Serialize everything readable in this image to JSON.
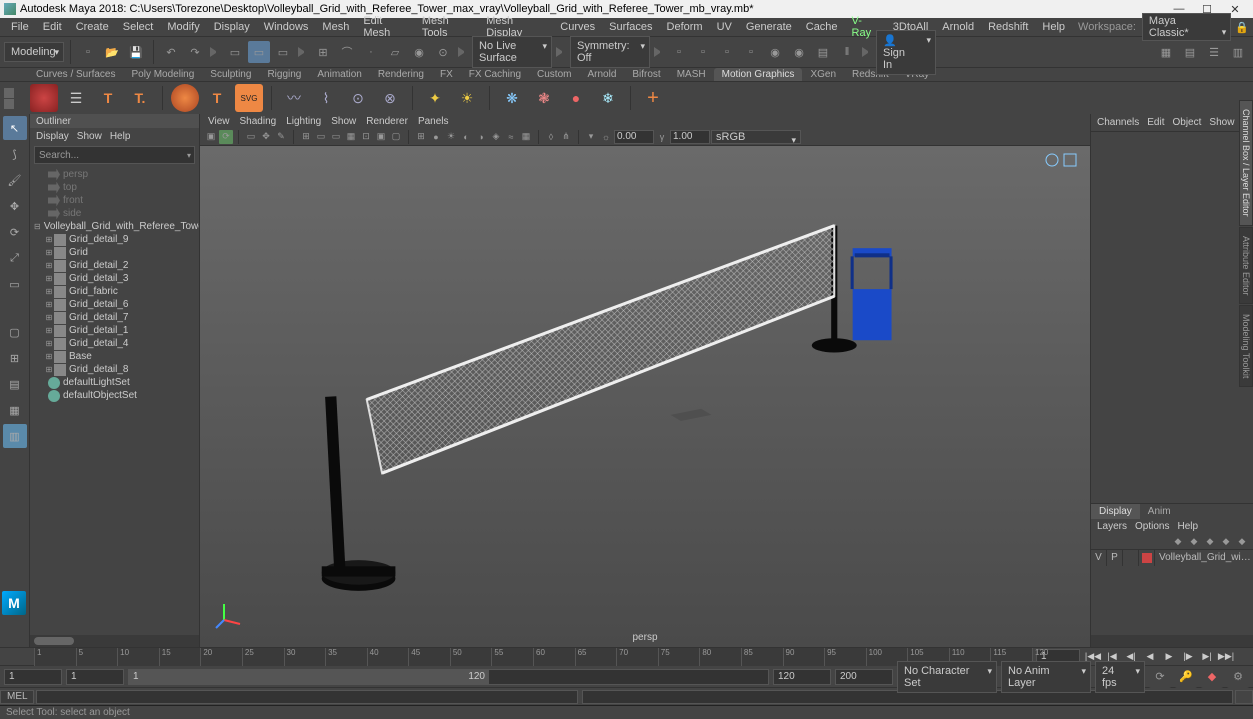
{
  "title": "Autodesk Maya 2018: C:\\Users\\Torezone\\Desktop\\Volleyball_Grid_with_Referee_Tower_max_vray\\Volleyball_Grid_with_Referee_Tower_mb_vray.mb*",
  "workspace_label": "Workspace:",
  "workspace_value": "Maya Classic*",
  "menubar": [
    "File",
    "Edit",
    "Create",
    "Select",
    "Modify",
    "Display",
    "Windows",
    "Mesh",
    "Edit Mesh",
    "Mesh Tools",
    "Mesh Display",
    "Curves",
    "Surfaces",
    "Deform",
    "UV",
    "Generate",
    "Cache",
    "V-Ray",
    "3DtoAll",
    "Arnold",
    "Redshift",
    "Help"
  ],
  "mode_combo": "Modeling",
  "no_live_surface": "No Live Surface",
  "symmetry": "Symmetry: Off",
  "signin": "Sign In",
  "shelf_tabs": [
    "Curves / Surfaces",
    "Poly Modeling",
    "Sculpting",
    "Rigging",
    "Animation",
    "Rendering",
    "FX",
    "FX Caching",
    "Custom",
    "Arnold",
    "Bifrost",
    "MASH",
    "Motion Graphics",
    "XGen",
    "Redshift",
    "VRay"
  ],
  "shelf_active_idx": 12,
  "outliner": {
    "title": "Outliner",
    "menu": [
      "Display",
      "Show",
      "Help"
    ],
    "search_placeholder": "Search...",
    "cameras": [
      "persp",
      "top",
      "front",
      "side"
    ],
    "root": "Volleyball_Grid_with_Referee_Tower_",
    "children": [
      "Grid_detail_9",
      "Grid",
      "Grid_detail_2",
      "Grid_detail_3",
      "Grid_fabric",
      "Grid_detail_6",
      "Grid_detail_7",
      "Grid_detail_1",
      "Grid_detail_4",
      "Base",
      "Grid_detail_8"
    ],
    "sets": [
      "defaultLightSet",
      "defaultObjectSet"
    ]
  },
  "viewport": {
    "menu": [
      "View",
      "Shading",
      "Lighting",
      "Show",
      "Renderer",
      "Panels"
    ],
    "exposure": "0.00",
    "gamma": "1.00",
    "colorspace": "sRGB gamma",
    "camera_label": "persp"
  },
  "channelbox": {
    "menu": [
      "Channels",
      "Edit",
      "Object",
      "Show"
    ]
  },
  "layers": {
    "tabs": [
      "Display",
      "Anim"
    ],
    "menu": [
      "Layers",
      "Options",
      "Help"
    ],
    "row": {
      "v": "V",
      "p": "P",
      "name": "Volleyball_Grid_with_Referee_"
    }
  },
  "right_vtabs": [
    "Channel Box / Layer Editor",
    "Attribute Editor",
    "Modeling Toolkit"
  ],
  "timeline": {
    "current": "1",
    "ticks": [
      "1",
      "5",
      "10",
      "15",
      "20",
      "25",
      "30",
      "35",
      "40",
      "45",
      "50",
      "55",
      "60",
      "65",
      "70",
      "75",
      "80",
      "85",
      "90",
      "95",
      "100",
      "105",
      "110",
      "115",
      "120"
    ]
  },
  "range": {
    "start_outer": "1",
    "start_inner": "1",
    "slider_start": "1",
    "slider_end": "120",
    "end_inner": "120",
    "end_outer": "200",
    "char_set": "No Character Set",
    "anim_layer": "No Anim Layer",
    "fps": "24 fps"
  },
  "cmd": {
    "lang": "MEL"
  },
  "helpline": "Select Tool: select an object"
}
